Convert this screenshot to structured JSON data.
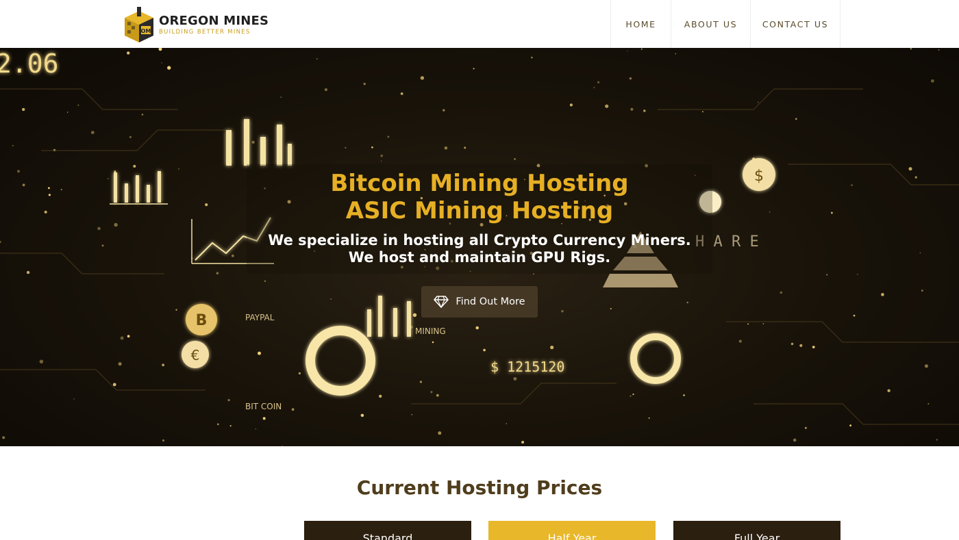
{
  "brand": {
    "name": "OREGON MINES",
    "tagline": "BUILDING BETTER MINES",
    "monogram": "OM"
  },
  "nav": {
    "items": [
      {
        "label": "HOME"
      },
      {
        "label": "ABOUT US"
      },
      {
        "label": "CONTACT US"
      }
    ]
  },
  "hero": {
    "title_line1": "Bitcoin Mining Hosting",
    "title_line2": "ASIC Mining Hosting",
    "subtitle_line1": "We specialize in hosting all Crypto Currency Miners.",
    "subtitle_line2": "We host and maintain GPU Rigs.",
    "cta_label": "Find Out More",
    "cta_icon": "diamond-icon",
    "background_text": {
      "number_top": "2.06",
      "paypal": "PAYPAL",
      "mining": "MINING",
      "bitcoin": "BIT COIN",
      "amount": "$ 1215120",
      "share": "H A R E"
    }
  },
  "pricing": {
    "title": "Current Hosting Prices",
    "plans": [
      {
        "name": "Standard"
      },
      {
        "name": "Half Year"
      },
      {
        "name": "Full Year"
      }
    ]
  },
  "colors": {
    "accent": "#e6b024",
    "dark": "#2b1f0f",
    "heading": "#4f3d1c"
  }
}
